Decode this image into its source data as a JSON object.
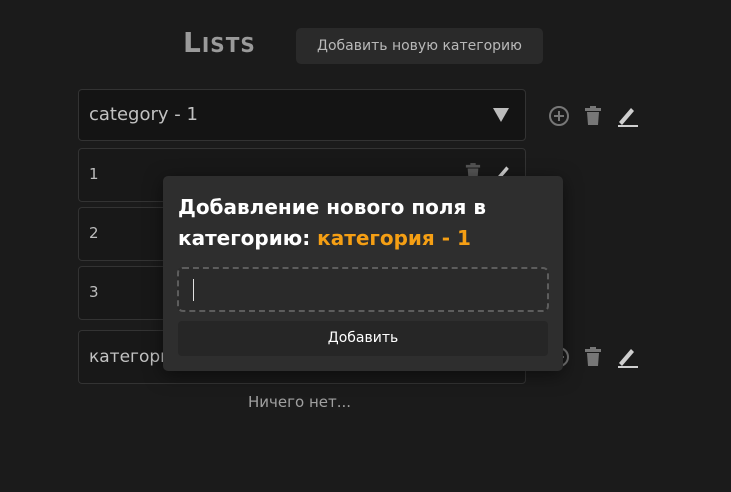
{
  "header": {
    "title": "Lists",
    "add_category_label": "Добавить новую категорию"
  },
  "category_1": {
    "selected": "category - 1",
    "items": [
      "1",
      "2",
      "3"
    ]
  },
  "category_2": {
    "label": "категори"
  },
  "empty_label": "Ничего нет...",
  "modal": {
    "title_text": "Добавление нового поля в категорию: ",
    "title_accent": "категория - 1",
    "input_value": "",
    "submit_label": "Добавить",
    "accent_color": "#f59f14"
  },
  "icons": [
    "plus-circle-icon",
    "trash-icon",
    "pencil-icon",
    "chevron-down-icon"
  ]
}
